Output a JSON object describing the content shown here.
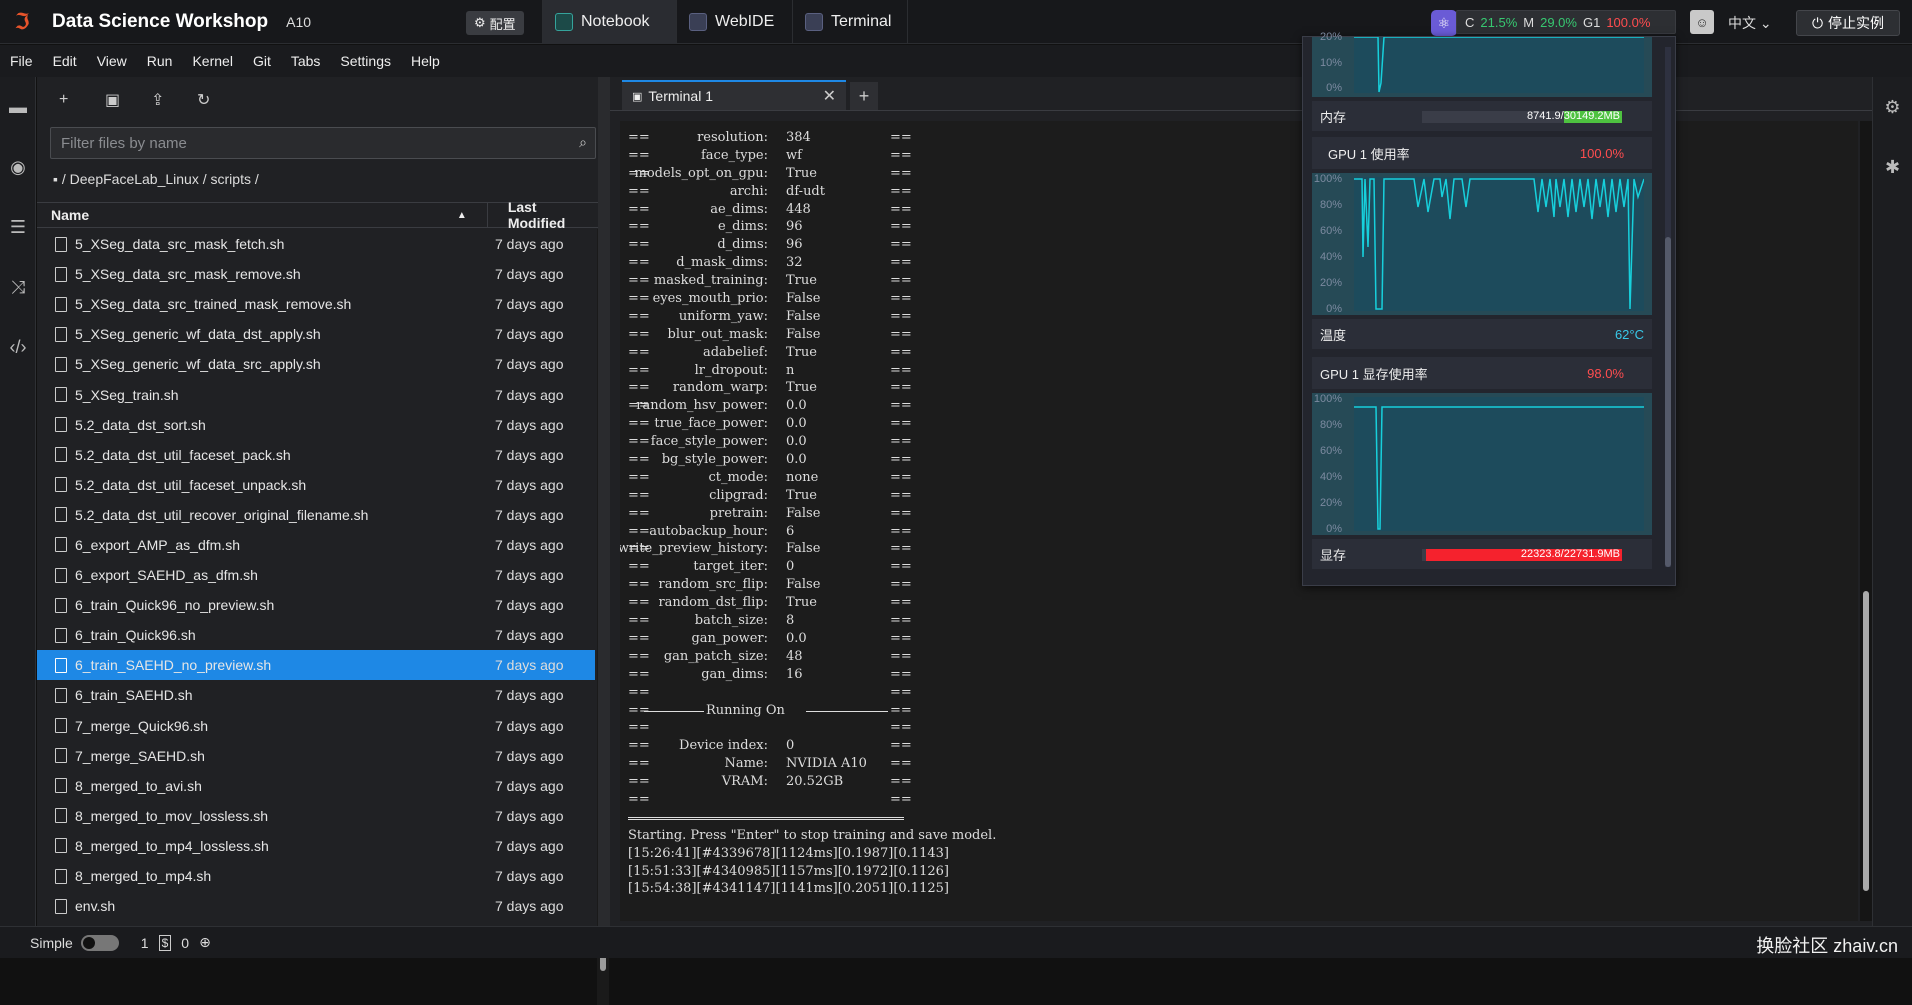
{
  "topbar": {
    "app_title": "Data Science Workshop",
    "gpu": "A10",
    "config_label": "配置",
    "tabs": [
      {
        "label": "Notebook"
      },
      {
        "label": "WebIDE"
      },
      {
        "label": "Terminal"
      }
    ],
    "stats": {
      "c_label": "C",
      "c_value": "21.5%",
      "m_label": "M",
      "m_value": "29.0%",
      "g_label": "G1",
      "g_value": "100.0%"
    },
    "lang": "中文",
    "stop_label": "停止实例"
  },
  "menu": [
    "File",
    "Edit",
    "View",
    "Run",
    "Kernel",
    "Git",
    "Tabs",
    "Settings",
    "Help"
  ],
  "file_panel": {
    "search_placeholder": "Filter files by name",
    "breadcrumb": "/ DeepFaceLab_Linux / scripts /",
    "col_name": "Name",
    "col_modified": "Last Modified",
    "files": [
      {
        "name": "5_XSeg_data_src_mask_fetch.sh",
        "modified": "7 days ago"
      },
      {
        "name": "5_XSeg_data_src_mask_remove.sh",
        "modified": "7 days ago"
      },
      {
        "name": "5_XSeg_data_src_trained_mask_remove.sh",
        "modified": "7 days ago"
      },
      {
        "name": "5_XSeg_generic_wf_data_dst_apply.sh",
        "modified": "7 days ago"
      },
      {
        "name": "5_XSeg_generic_wf_data_src_apply.sh",
        "modified": "7 days ago"
      },
      {
        "name": "5_XSeg_train.sh",
        "modified": "7 days ago"
      },
      {
        "name": "5.2_data_dst_sort.sh",
        "modified": "7 days ago"
      },
      {
        "name": "5.2_data_dst_util_faceset_pack.sh",
        "modified": "7 days ago"
      },
      {
        "name": "5.2_data_dst_util_faceset_unpack.sh",
        "modified": "7 days ago"
      },
      {
        "name": "5.2_data_dst_util_recover_original_filename.sh",
        "modified": "7 days ago"
      },
      {
        "name": "6_export_AMP_as_dfm.sh",
        "modified": "7 days ago"
      },
      {
        "name": "6_export_SAEHD_as_dfm.sh",
        "modified": "7 days ago"
      },
      {
        "name": "6_train_Quick96_no_preview.sh",
        "modified": "7 days ago"
      },
      {
        "name": "6_train_Quick96.sh",
        "modified": "7 days ago"
      },
      {
        "name": "6_train_SAEHD_no_preview.sh",
        "modified": "7 days ago",
        "selected": true
      },
      {
        "name": "6_train_SAEHD.sh",
        "modified": "7 days ago"
      },
      {
        "name": "7_merge_Quick96.sh",
        "modified": "7 days ago"
      },
      {
        "name": "7_merge_SAEHD.sh",
        "modified": "7 days ago"
      },
      {
        "name": "8_merged_to_avi.sh",
        "modified": "7 days ago"
      },
      {
        "name": "8_merged_to_mov_lossless.sh",
        "modified": "7 days ago"
      },
      {
        "name": "8_merged_to_mp4_lossless.sh",
        "modified": "7 days ago"
      },
      {
        "name": "8_merged_to_mp4.sh",
        "modified": "7 days ago"
      },
      {
        "name": "env.sh",
        "modified": "7 days ago"
      }
    ]
  },
  "terminal": {
    "tab_label": "Terminal 1",
    "params": [
      {
        "k": "resolution:",
        "v": "384"
      },
      {
        "k": "face_type:",
        "v": "wf"
      },
      {
        "k": "models_opt_on_gpu:",
        "v": "True"
      },
      {
        "k": "archi:",
        "v": "df-udt"
      },
      {
        "k": "ae_dims:",
        "v": "448"
      },
      {
        "k": "e_dims:",
        "v": "96"
      },
      {
        "k": "d_dims:",
        "v": "96"
      },
      {
        "k": "d_mask_dims:",
        "v": "32"
      },
      {
        "k": "masked_training:",
        "v": "True"
      },
      {
        "k": "eyes_mouth_prio:",
        "v": "False"
      },
      {
        "k": "uniform_yaw:",
        "v": "False"
      },
      {
        "k": "blur_out_mask:",
        "v": "False"
      },
      {
        "k": "adabelief:",
        "v": "True"
      },
      {
        "k": "lr_dropout:",
        "v": "n"
      },
      {
        "k": "random_warp:",
        "v": "True"
      },
      {
        "k": "random_hsv_power:",
        "v": "0.0"
      },
      {
        "k": "true_face_power:",
        "v": "0.0"
      },
      {
        "k": "face_style_power:",
        "v": "0.0"
      },
      {
        "k": "bg_style_power:",
        "v": "0.0"
      },
      {
        "k": "ct_mode:",
        "v": "none"
      },
      {
        "k": "clipgrad:",
        "v": "True"
      },
      {
        "k": "pretrain:",
        "v": "False"
      },
      {
        "k": "autobackup_hour:",
        "v": "6"
      },
      {
        "k": "write_preview_history:",
        "v": "False"
      },
      {
        "k": "target_iter:",
        "v": "0"
      },
      {
        "k": "random_src_flip:",
        "v": "False"
      },
      {
        "k": "random_dst_flip:",
        "v": "True"
      },
      {
        "k": "batch_size:",
        "v": "8"
      },
      {
        "k": "gan_power:",
        "v": "0.0"
      },
      {
        "k": "gan_patch_size:",
        "v": "48"
      },
      {
        "k": "gan_dims:",
        "v": "16"
      }
    ],
    "running_on": "Running On",
    "device": [
      {
        "k": "Device index:",
        "v": "0"
      },
      {
        "k": "Name:",
        "v": "NVIDIA A10"
      },
      {
        "k": "VRAM:",
        "v": "20.52GB"
      }
    ],
    "start_line": "Starting. Press \"Enter\" to stop training and save model.",
    "log_lines": [
      "[15:26:41][#4339678][1124ms][0.1987][0.1143]",
      "[15:51:33][#4340985][1157ms][0.1972][0.1126]",
      "[15:54:38][#4341147][1141ms][0.2051][0.1125]"
    ]
  },
  "statusbar": {
    "mode": "Simple",
    "count1": "1",
    "count2": "0"
  },
  "watermark": "换脸社区 zhaiv.cn",
  "monitor": {
    "mem_label": "内存",
    "mem_text": "8741.9/30149.2MB",
    "mem_fraction": 0.29,
    "gpu_util_title": "GPU 1 使用率",
    "gpu_util_value": "100.0%",
    "temp_label": "温度",
    "temp_value": "62°C",
    "gpu_mem_title": "GPU 1 显存使用率",
    "gpu_mem_value": "98.0%",
    "vram_label": "显存",
    "vram_text": "22323.8/22731.9MB",
    "vram_fraction": 0.98,
    "y_ticks": [
      "100%",
      "80%",
      "60%",
      "40%",
      "20%",
      "0%"
    ],
    "top_chart_ticks": [
      "20%",
      "10%",
      "0%"
    ]
  }
}
